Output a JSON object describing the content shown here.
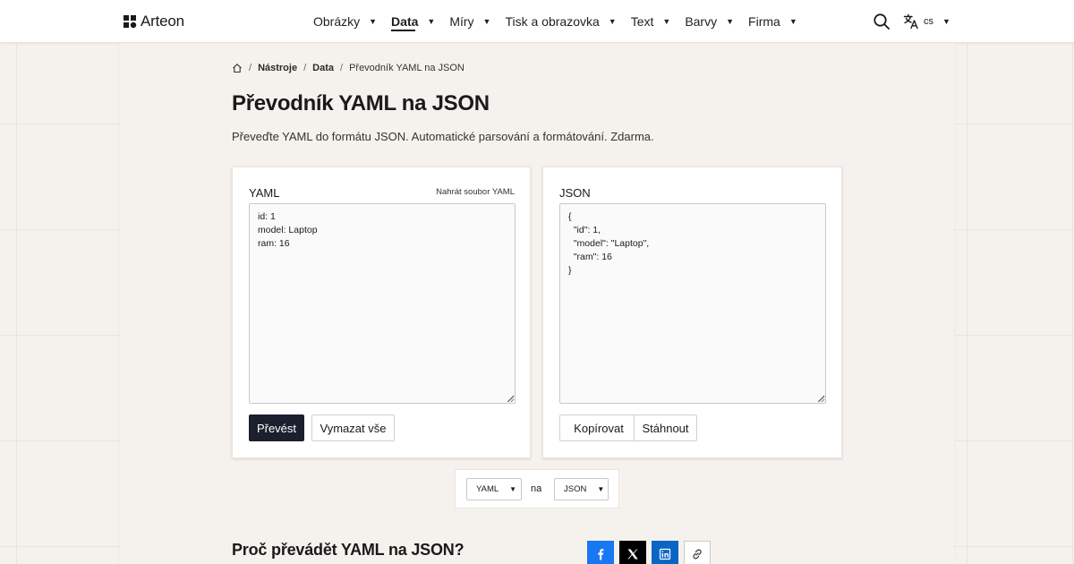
{
  "brand": {
    "name": "Arteon"
  },
  "nav": {
    "items": [
      {
        "label": "Obrázky",
        "active": false
      },
      {
        "label": "Data",
        "active": true
      },
      {
        "label": "Míry",
        "active": false
      },
      {
        "label": "Tisk a obrazovka",
        "active": false
      },
      {
        "label": "Text",
        "active": false
      },
      {
        "label": "Barvy",
        "active": false
      },
      {
        "label": "Firma",
        "active": false
      }
    ],
    "caret": "▼"
  },
  "language": {
    "code": "cs"
  },
  "breadcrumb": {
    "items": [
      "Nástroje",
      "Data",
      "Převodník YAML na JSON"
    ],
    "separator": "/"
  },
  "page": {
    "title": "Převodník YAML na JSON",
    "description": "Převeďte YAML do formátu JSON. Automatické parsování a formátování. Zdarma."
  },
  "input_panel": {
    "title": "YAML",
    "upload_label": "Nahrát soubor YAML",
    "content": "id: 1\nmodel: Laptop\nram: 16",
    "convert_label": "Převést",
    "clear_label": "Vymazat vše"
  },
  "output_panel": {
    "title": "JSON",
    "content": "{\n  \"id\": 1,\n  \"model\": \"Laptop\",\n  \"ram\": 16\n}",
    "copy_label": "Kopírovat",
    "download_label": "Stáhnout"
  },
  "format_selector": {
    "from": "YAML",
    "connector": "na",
    "to": "JSON"
  },
  "section": {
    "heading": "Proč převádět YAML na JSON?"
  },
  "share": {
    "icons": [
      "facebook-icon",
      "x-icon",
      "linkedin-icon",
      "link-icon"
    ]
  },
  "colors": {
    "primary_button": "#1c1f2e",
    "facebook": "#1877f2",
    "x": "#000000",
    "linkedin": "#0a66c2",
    "page_background": "#f5f2ed"
  }
}
